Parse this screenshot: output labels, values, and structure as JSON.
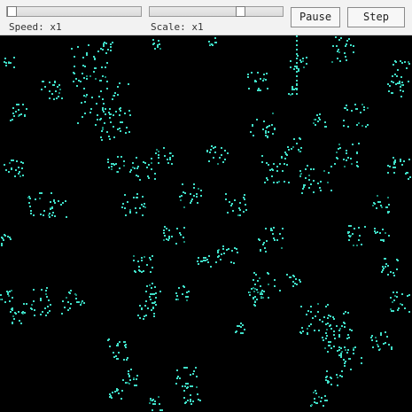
{
  "toolbar": {
    "speed_label": "Speed: x1",
    "scale_label": "Scale: x1",
    "pause_label": "Pause",
    "step_label": "Step",
    "speed_value_fraction": 0.0,
    "scale_value_fraction": 0.7
  },
  "simulation": {
    "background_color": "#000000",
    "cell_color": "#40e0c8",
    "dim_cell_color": "#1a8a78"
  }
}
